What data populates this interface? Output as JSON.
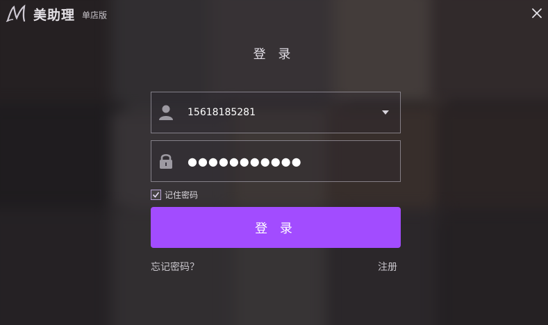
{
  "app": {
    "name": "美助理",
    "edition": "单店版"
  },
  "login": {
    "title": "登 录",
    "username_value": "15618185281",
    "password_masked": "●●●●●●●●●●●",
    "remember_label": "记住密码",
    "remember_checked": true,
    "submit_label": "登 录",
    "forgot_label": "忘记密码？",
    "register_label": "注册"
  },
  "icons": {
    "logo": "logo-m-icon",
    "close": "close-icon",
    "user": "user-icon",
    "lock": "lock-icon",
    "dropdown": "chevron-down-icon",
    "check": "checkmark-icon"
  },
  "colors": {
    "accent": "#a24cff",
    "checkbox_border": "#b8a3d6"
  }
}
